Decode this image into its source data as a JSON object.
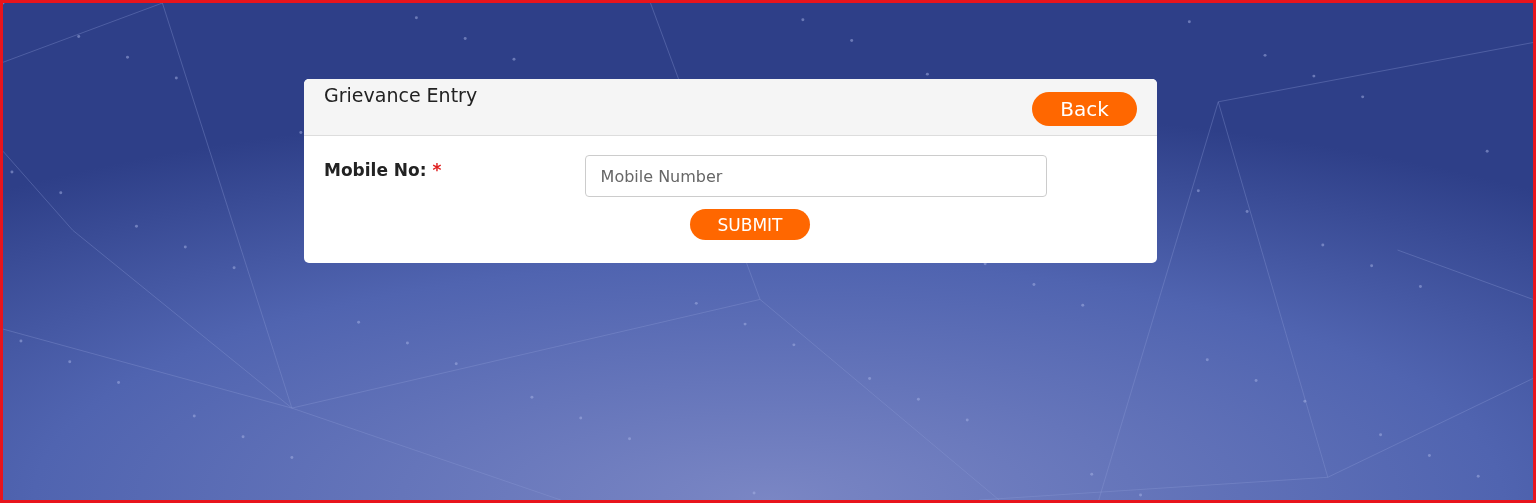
{
  "card": {
    "title": "Grievance Entry",
    "back_button": "Back"
  },
  "form": {
    "fields": [
      {
        "label": "Mobile No:",
        "required": true,
        "required_mark": "*",
        "placeholder": "Mobile Number"
      }
    ],
    "submit_button": "SUBMIT"
  }
}
